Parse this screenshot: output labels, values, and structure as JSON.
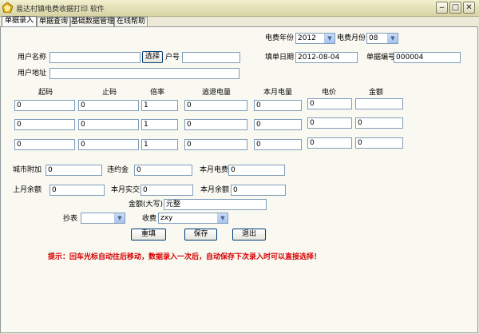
{
  "window": {
    "title": "易达村镇电费收据打印 软件"
  },
  "tabs": [
    "单据录入",
    "单据查询",
    "基础数据管理",
    "在线帮助"
  ],
  "header": {
    "year_label": "电费年份",
    "year_value": "2012",
    "month_label": "电费月份",
    "month_value": "08",
    "user_name_label": "用户名称",
    "user_name_value": "",
    "select_button": "选择",
    "account_label": "户号",
    "account_value": "",
    "fill_date_label": "填单日期",
    "fill_date_value": "2012-08-04",
    "receipt_no_label": "单据编号",
    "receipt_no_value": "000004",
    "address_label": "用户地址",
    "address_value": ""
  },
  "grid": {
    "columns": [
      "起码",
      "止码",
      "倍率",
      "追退电量",
      "本月电量",
      "电价",
      "金额"
    ],
    "rows": [
      [
        "0",
        "0",
        "1",
        "0",
        "0",
        "0",
        ""
      ],
      [
        "0",
        "0",
        "1",
        "0",
        "0",
        "0",
        "0"
      ],
      [
        "0",
        "0",
        "1",
        "0",
        "0",
        "0",
        "0"
      ]
    ]
  },
  "summary": {
    "city_surcharge_label": "城市附加",
    "city_surcharge_value": "0",
    "penalty_label": "违约金",
    "penalty_value": "0",
    "month_fee_label": "本月电费",
    "month_fee_value": "0",
    "last_balance_label": "上月余额",
    "last_balance_value": "0",
    "actual_paid_label": "本月实交",
    "actual_paid_value": "0",
    "this_balance_label": "本月余额",
    "this_balance_value": "0",
    "amount_upper_label": "金额(大写)",
    "amount_upper_value": "元整",
    "meter_reader_label": "抄表",
    "meter_reader_value": "",
    "collector_label": "收费",
    "collector_value": "zxy"
  },
  "buttons": {
    "refill": "重填",
    "save": "保存",
    "exit": "退出"
  },
  "tip": "提示：回车光标自动往后移动，数据录入一次后，自动保存下次录入时可以直接选择！"
}
